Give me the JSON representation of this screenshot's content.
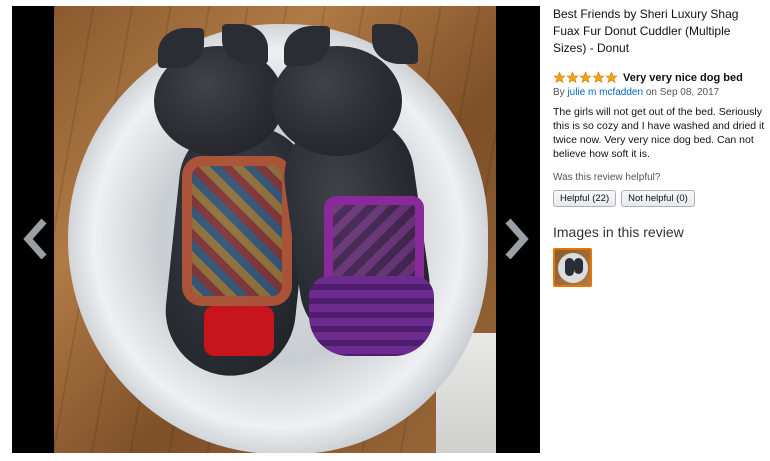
{
  "product": {
    "title": "Best Friends by Sheri Luxury Shag Fuax Fur Donut Cuddler (Multiple Sizes) - Donut"
  },
  "review": {
    "rating": 5,
    "rating_max": 5,
    "title": "Very very nice dog bed",
    "by_prefix": "By",
    "author": "julie m mcfadden",
    "date_text": "on Sep 08, 2017",
    "body": "The girls will not get out of the bed. Seriously this is so cozy and I have washed and dried it twice now. Very very nice dog bed. Can not believe how soft it is.",
    "helpful_question": "Was this review helpful?",
    "helpful_button": "Helpful (22)",
    "not_helpful_button": "Not helpful (0)"
  },
  "images_section": {
    "title": "Images in this review",
    "thumbnails": [
      "two-dogs-in-bed-thumbnail"
    ]
  },
  "viewer": {
    "prev_icon": "chevron-left-icon",
    "next_icon": "chevron-right-icon",
    "main_image": "two-french-bulldogs-in-donut-bed"
  },
  "colors": {
    "star": "#f2a30f",
    "link": "#0066c0",
    "thumb_border": "#e77600",
    "viewer_bg": "#000000"
  }
}
